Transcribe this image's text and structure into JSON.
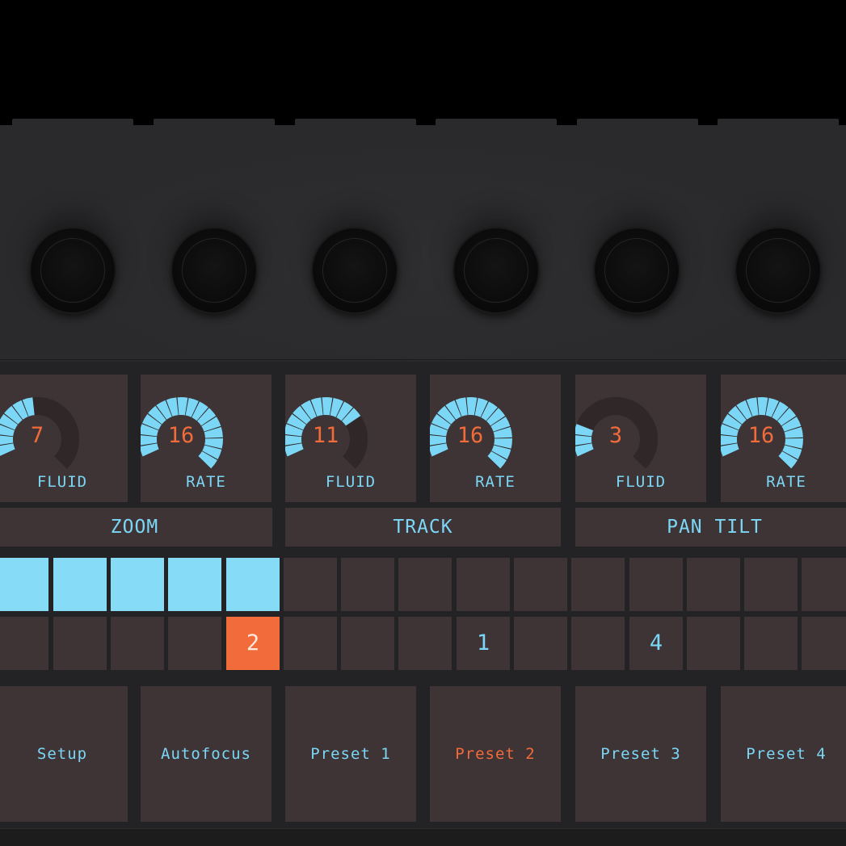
{
  "colors": {
    "accent_blue": "#7bd7f5",
    "accent_orange": "#f26b3a",
    "pad": "#3e3335",
    "housing": "#2a2a2c"
  },
  "dials": [
    {
      "value": "7",
      "label": "FLUID",
      "level": 0.44
    },
    {
      "value": "16",
      "label": "RATE",
      "level": 1.0
    },
    {
      "value": "11",
      "label": "FLUID",
      "level": 0.69
    },
    {
      "value": "16",
      "label": "RATE",
      "level": 1.0
    },
    {
      "value": "3",
      "label": "FLUID",
      "level": 0.19
    },
    {
      "value": "16",
      "label": "RATE",
      "level": 1.0
    }
  ],
  "groups": [
    {
      "label": "ZOOM"
    },
    {
      "label": "TRACK"
    },
    {
      "label": "PAN TILT"
    }
  ],
  "grid": {
    "row1_lit": [
      true,
      true,
      true,
      true,
      true,
      false,
      false,
      false,
      false,
      false,
      false,
      false,
      false,
      false,
      false
    ],
    "row2_labels": [
      "",
      "",
      "",
      "",
      "2",
      "",
      "",
      "",
      "1",
      "",
      "",
      "4",
      "",
      "",
      ""
    ],
    "row2_selected_index": 4
  },
  "buttons": [
    {
      "label": "Setup"
    },
    {
      "label": "Autofocus"
    },
    {
      "label": "Preset 1"
    },
    {
      "label": "Preset 2",
      "active": true
    },
    {
      "label": "Preset 3"
    },
    {
      "label": "Preset 4"
    }
  ]
}
